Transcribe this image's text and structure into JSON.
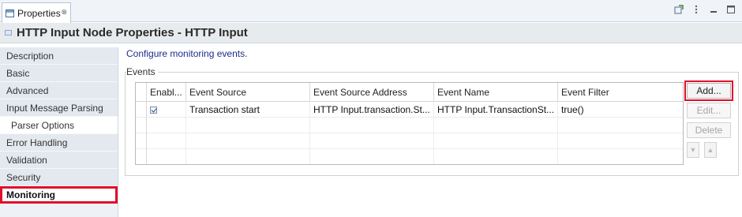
{
  "tab": {
    "label": "Properties",
    "close_glyph": "⊗"
  },
  "header": {
    "title": "HTTP Input Node Properties - HTTP Input"
  },
  "nav": {
    "items": [
      {
        "label": "Description"
      },
      {
        "label": "Basic"
      },
      {
        "label": "Advanced"
      },
      {
        "label": "Input Message Parsing"
      },
      {
        "label": "Parser Options"
      },
      {
        "label": "Error Handling"
      },
      {
        "label": "Validation"
      },
      {
        "label": "Security"
      },
      {
        "label": "Monitoring"
      }
    ],
    "active": "Monitoring"
  },
  "main": {
    "description": "Configure monitoring events.",
    "group_label": "Events"
  },
  "table": {
    "columns": [
      "Enabl...",
      "Event Source",
      "Event Source Address",
      "Event Name",
      "Event Filter"
    ],
    "rows": [
      {
        "enabled": true,
        "event_source": "Transaction start",
        "event_source_address": "HTTP Input.transaction.St...",
        "event_name": "HTTP Input.TransactionSt...",
        "event_filter": "true()"
      }
    ]
  },
  "buttons": {
    "add": "Add...",
    "edit": "Edit...",
    "delete": "Delete"
  },
  "colors": {
    "highlight": "#e0102a",
    "link_text": "#1b2d8a"
  }
}
